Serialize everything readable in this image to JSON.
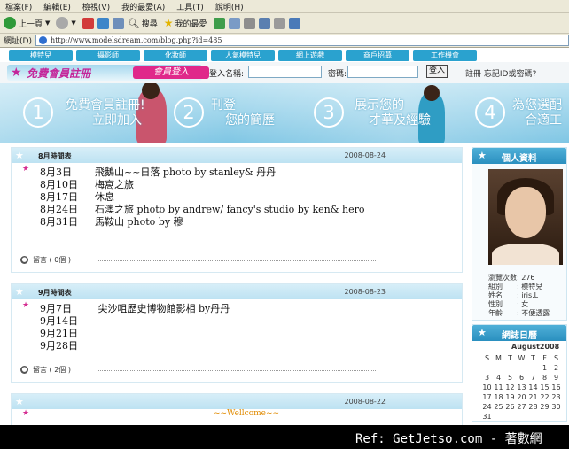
{
  "menu": [
    "檔案(F)",
    "編輯(E)",
    "檢視(V)",
    "我的最愛(A)",
    "工具(T)",
    "說明(H)"
  ],
  "toolbar": {
    "back": "上一頁",
    "search": "搜尋",
    "favorites": "我的最愛"
  },
  "address": {
    "label": "網址(D)",
    "url": "http://www.modelsdream.com/blog.php?id=485"
  },
  "nav": [
    "模特兒",
    "攝影師",
    "化妝師",
    "人氣模特兒",
    "網上遊戲",
    "商戶招募",
    "工作機會"
  ],
  "login": {
    "register": "免費會員註冊",
    "member_login": "會員登入",
    "name_label": "登入名稱:",
    "password_label": "密碼:",
    "button": "登入",
    "links": "註冊  忘記ID或密碼?"
  },
  "banner": {
    "step1": {
      "num": "1",
      "line1": "免費會員註冊!",
      "line2": "立即加入"
    },
    "step2": {
      "num": "2",
      "line1": "刊登",
      "line2": "您的簡歷"
    },
    "step3": {
      "num": "3",
      "line1": "展示您的",
      "line2": "才華及經驗"
    },
    "step4": {
      "num": "4",
      "line1": "為您選配",
      "line2": "合適工"
    }
  },
  "posts": [
    {
      "title": "8月時間表",
      "date": "2008-08-24",
      "entries": [
        {
          "date": "8月3日",
          "text": "飛鵝山~~日落 photo by stanley& 丹丹"
        },
        {
          "date": "8月10日",
          "text": "梅窩之旅"
        },
        {
          "date": "8月17日",
          "text": "休息"
        },
        {
          "date": "8月24日",
          "text": "石澳之旅 photo by andrew/ fancy's studio by ken& hero"
        },
        {
          "date": "8月31日",
          "text": "馬鞍山  photo by 穆"
        }
      ],
      "comments": "留言 ( 0個 )"
    },
    {
      "title": "9月時間表",
      "date": "2008-08-23",
      "entries": [
        {
          "date": "9月7日",
          "text": "    尖沙咀歷史博物館影相 by丹丹"
        },
        {
          "date": "9月14日",
          "text": ""
        },
        {
          "date": "9月21日",
          "text": ""
        },
        {
          "date": "9月28日",
          "text": ""
        }
      ],
      "comments": "留言 ( 2個 )"
    },
    {
      "title": "",
      "date": "2008-08-22",
      "entries": [
        {
          "date": "",
          "text": "~~Wellcome~~"
        }
      ],
      "comments": ""
    }
  ],
  "profile": {
    "title": "個人資料",
    "rows": [
      {
        "k": "瀏覽次數",
        "v": ": 276"
      },
      {
        "k": "組別",
        "v": ": 模特兒"
      },
      {
        "k": "姓名",
        "v": ": iris.L"
      },
      {
        "k": "性別",
        "v": ": 女"
      },
      {
        "k": "年齡",
        "v": ": 不便透露"
      }
    ]
  },
  "calendar": {
    "title": "網誌日曆",
    "month": "August2008",
    "weekdays": [
      "S",
      "M",
      "T",
      "W",
      "T",
      "F",
      "S"
    ],
    "days": [
      "",
      "",
      "",
      "",
      "",
      "1",
      "2",
      "3",
      "4",
      "5",
      "6",
      "7",
      "8",
      "9",
      "10",
      "11",
      "12",
      "13",
      "14",
      "15",
      "16",
      "17",
      "18",
      "19",
      "20",
      "21",
      "22",
      "23",
      "24",
      "25",
      "26",
      "27",
      "28",
      "29",
      "30",
      "31"
    ]
  },
  "watermark": "Ref: GetJetso.com - 著數網"
}
